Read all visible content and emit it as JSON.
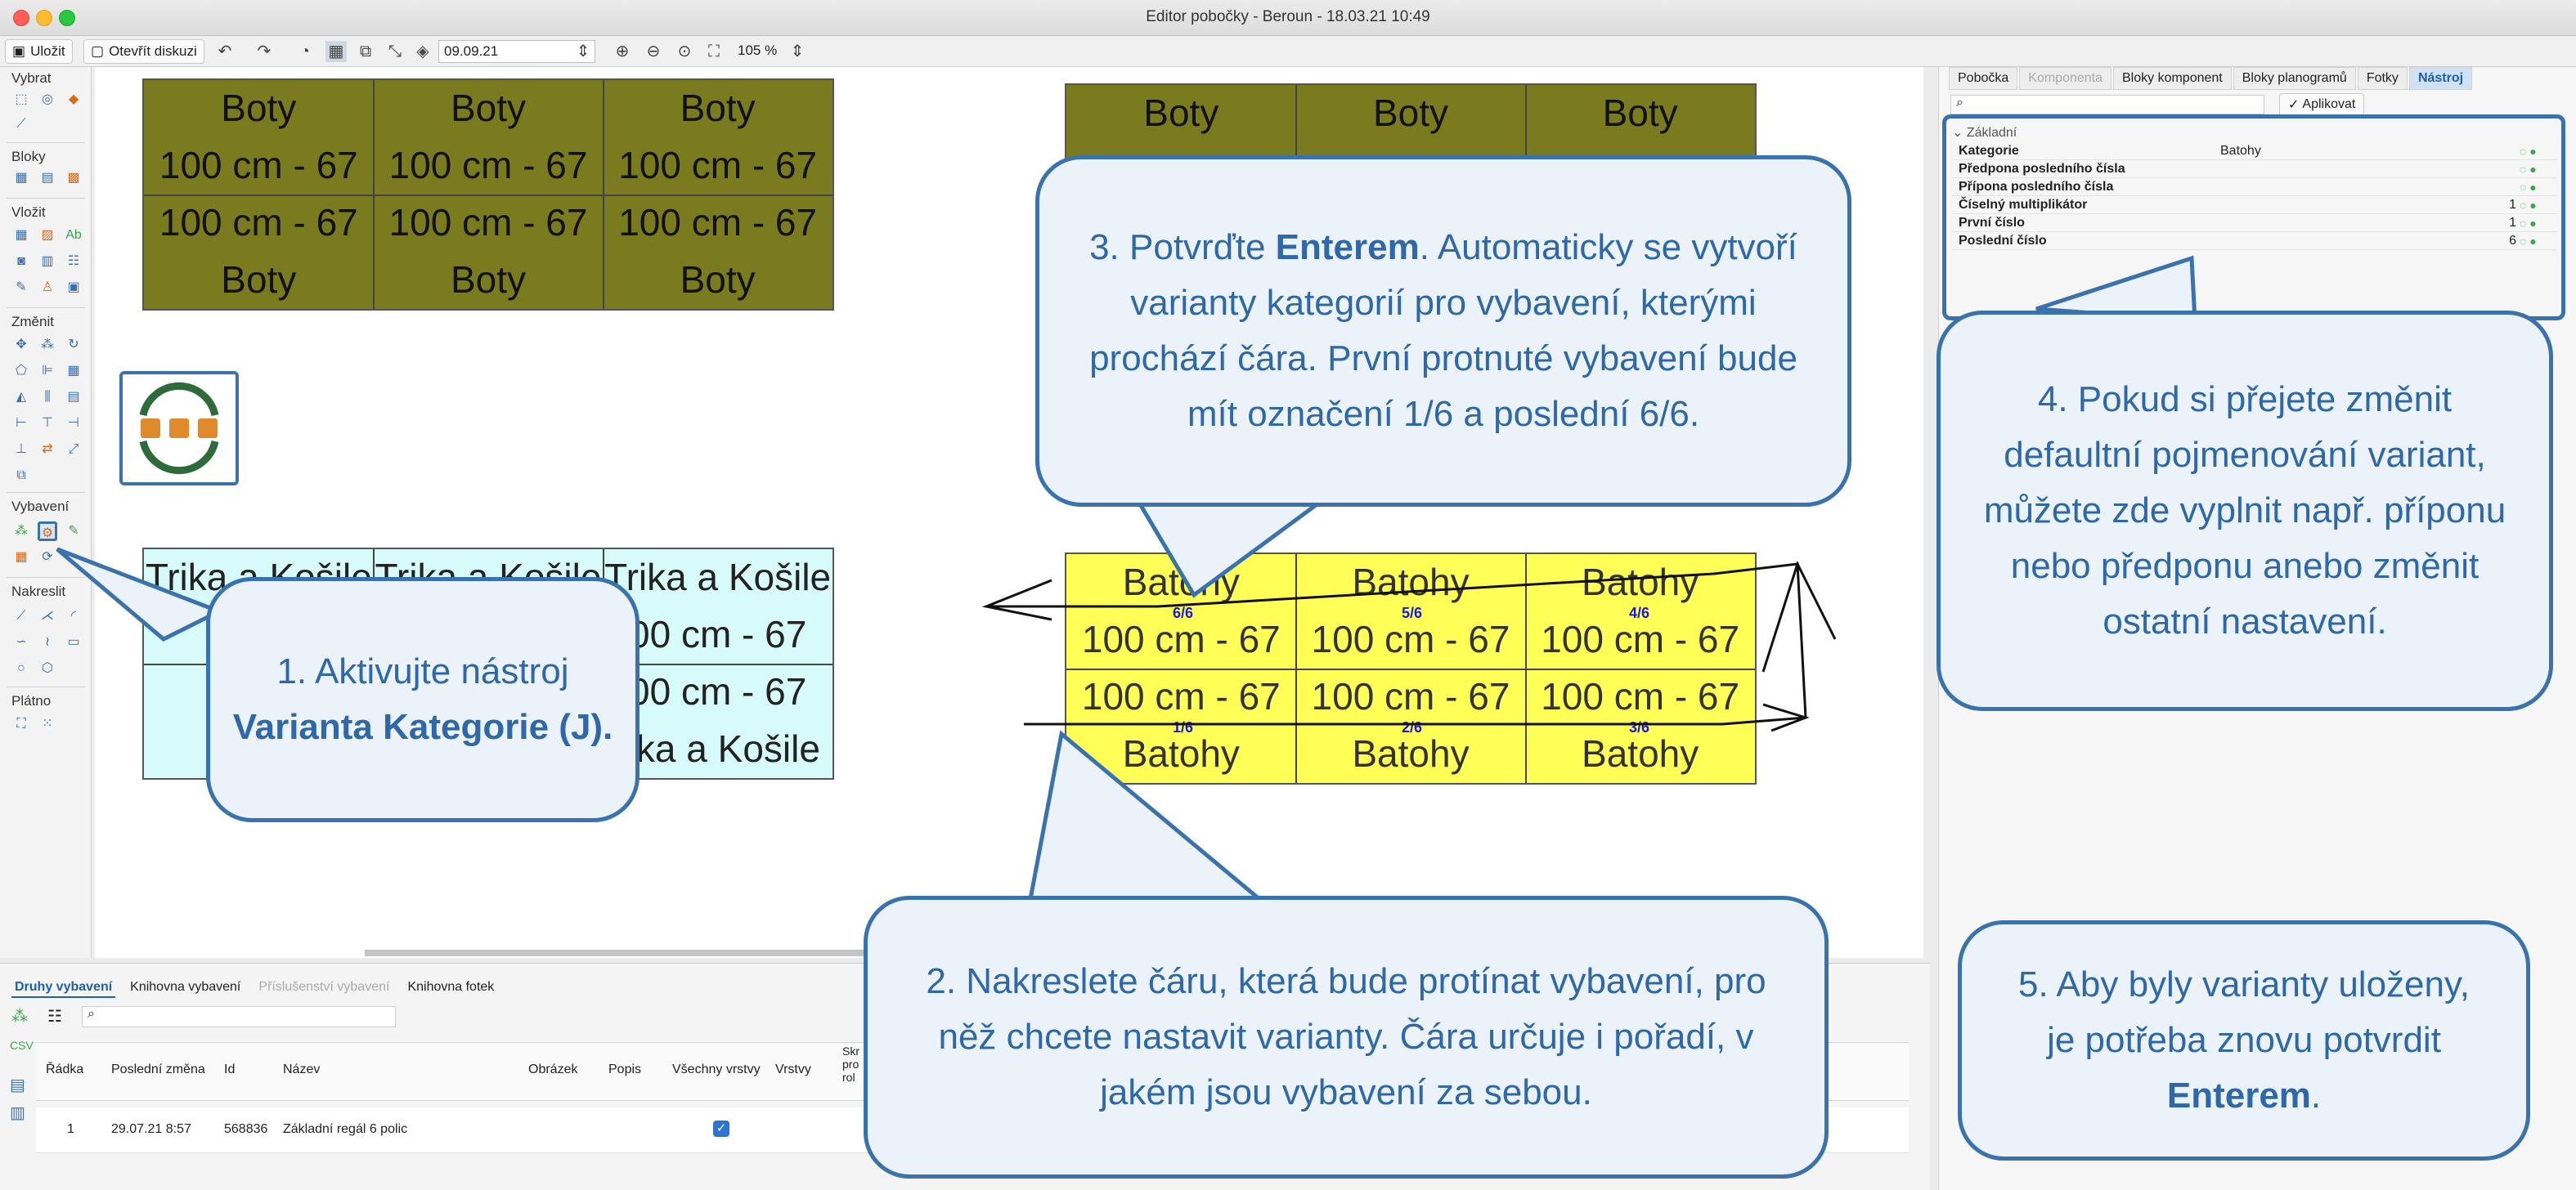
{
  "window": {
    "title": "Editor pobočky - Beroun - 18.03.21 10:49"
  },
  "toolbar": {
    "save_label": "Uložit",
    "open_discussion_label": "Otevřít diskuzi",
    "date_value": "09.09.21",
    "zoom_value": "105 %"
  },
  "palette": {
    "sections": {
      "vybrat": "Vybrat",
      "bloky": "Bloky",
      "vlozit": "Vložit",
      "zmenit": "Změnit",
      "vybaveni": "Vybavení",
      "nakreslit": "Nakreslit",
      "platno": "Plátno"
    }
  },
  "canvas": {
    "shelf_olive_left": [
      "Boty",
      "Boty",
      "Boty",
      "100 cm - 67",
      "100 cm - 67",
      "100 cm - 67",
      "100 cm - 67",
      "100 cm - 67",
      "100 cm - 67",
      "Boty",
      "Boty",
      "Boty"
    ],
    "shelf_olive_right": [
      "Boty",
      "Boty",
      "Boty"
    ],
    "shelf_cyan": [
      "Trika a Košile",
      "Trika a Košile",
      "Trika a Košile",
      "",
      "",
      "00 cm - 67",
      "100",
      "",
      "00 cm - 67",
      "Trik",
      "",
      "rika a Košile"
    ],
    "shelf_yellow": [
      "Batohy",
      "Batohy",
      "Batohy",
      "100 cm - 67",
      "100 cm - 67",
      "100 cm - 67",
      "100 cm - 67",
      "100 cm - 67",
      "100 cm - 67",
      "Batohy",
      "Batohy",
      "Batohy"
    ],
    "variant_labels_top": [
      "6/6",
      "5/6",
      "4/6"
    ],
    "variant_labels_bottom": [
      "1/6",
      "2/6",
      "3/6"
    ]
  },
  "callouts": {
    "c1_pre": "1. Aktivujte nástroj",
    "c1_bold": "Varianta Kategorie (J).",
    "c2": "2. Nakreslete čáru, která bude protínat vybavení, pro něž chcete nastavit varianty. Čára určuje i pořadí, v jakém jsou vybavení za sebou.",
    "c3_pre": "3. Potvrďte",
    "c3_bold": "Enterem",
    "c3_post": ". Automaticky se vytvoří varianty kategorií pro vybavení, kterými prochází čára. První protnuté vybavení bude mít označení 1/6 a poslední 6/6.",
    "c4": "4. Pokud si přejete změnit defaultní pojmenování variant, můžete zde vyplnit např. příponu nebo předponu anebo změnit ostatní nastavení.",
    "c5_pre": "5. Aby byly varianty uloženy, je potřeba znovu potvrdit",
    "c5_bold": "Enterem",
    "c5_post": "."
  },
  "bottom_panel": {
    "tabs": [
      "Druhy vybavení",
      "Knihovna vybavení",
      "Příslušenství vybavení",
      "Knihovna fotek"
    ],
    "columns": [
      "Řádka",
      "Poslední změna",
      "Id",
      "Název",
      "Obrázek",
      "Popis",
      "Všechny vrstvy",
      "Vrstvy",
      "Skr pro rol"
    ],
    "row": {
      "radka": "1",
      "posledni_zmena": "29.07.21 8:57",
      "id": "568836",
      "nazev": "Základní regál 6 polic"
    }
  },
  "right_panel": {
    "tabs": [
      "Pobočka",
      "Komponenta",
      "Bloky komponent",
      "Bloky planogramů",
      "Fotky",
      "Nástroj"
    ],
    "apply_label": "Aplikovat",
    "group_label": "Základní",
    "props": [
      {
        "k": "Kategorie",
        "v": "Batohy",
        "n": ""
      },
      {
        "k": "Předpona posledního čísla",
        "v": "",
        "n": ""
      },
      {
        "k": "Přípona posledního čísla",
        "v": "",
        "n": ""
      },
      {
        "k": "Číselný multiplikátor",
        "v": "",
        "n": "1"
      },
      {
        "k": "První číslo",
        "v": "",
        "n": "1"
      },
      {
        "k": "Poslední číslo",
        "v": "",
        "n": "6"
      }
    ]
  }
}
